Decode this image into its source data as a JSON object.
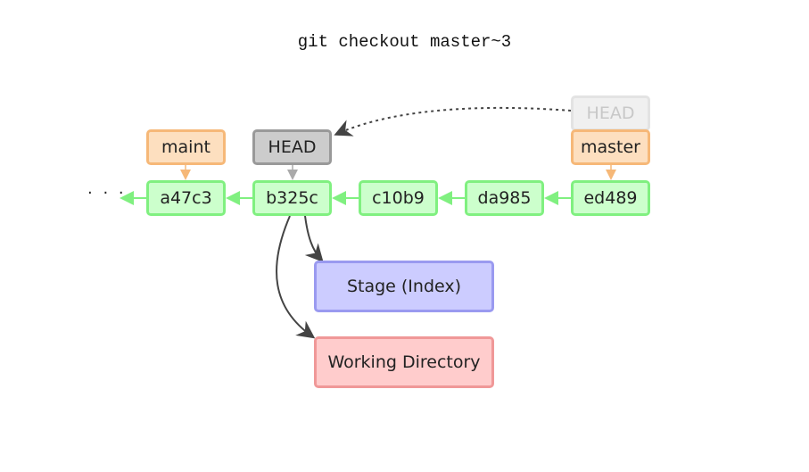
{
  "title": "git checkout master~3",
  "ellipsis": "· · ·",
  "commits": [
    {
      "id": "a47c3"
    },
    {
      "id": "b325c"
    },
    {
      "id": "c10b9"
    },
    {
      "id": "da985"
    },
    {
      "id": "ed489"
    }
  ],
  "refs": {
    "maint": "maint",
    "head": "HEAD",
    "head_old": "HEAD",
    "master": "master"
  },
  "areas": {
    "stage": "Stage (Index)",
    "working_directory": "Working Directory"
  },
  "colors": {
    "commit_fill": "#ccffcc",
    "commit_border": "#80f080",
    "branch_fill": "#fddfbf",
    "branch_border": "#f6b878",
    "head_fill": "#cccccc",
    "head_border": "#999999",
    "stage_fill": "#ccccff",
    "stage_border": "#9a9af0",
    "workdir_fill": "#ffcccc",
    "workdir_border": "#f09898"
  }
}
